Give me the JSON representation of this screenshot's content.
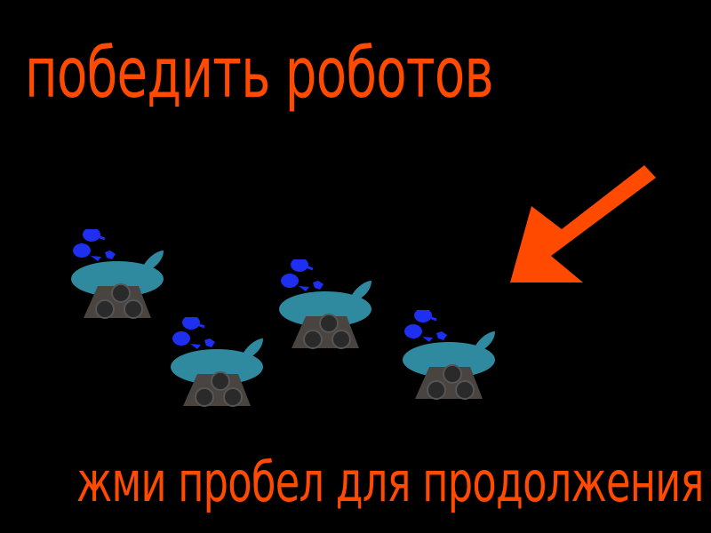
{
  "screen": {
    "title": "победить роботов",
    "prompt": "жми пробел для продолжения"
  },
  "colors": {
    "background": "#000000",
    "text": "#ff4a00",
    "arrow": "#ff4a00",
    "robot_body": "#2f8aa0",
    "robot_eyes": "#1e2ff0",
    "robot_base": "#4a4440",
    "robot_wheel": "#2a2a2a"
  },
  "icons": {
    "arrow": "pointer-arrow-icon",
    "robot": "robot-icon"
  },
  "robots": [
    {
      "name": "robot-1"
    },
    {
      "name": "robot-2"
    },
    {
      "name": "robot-3"
    },
    {
      "name": "robot-4"
    }
  ]
}
